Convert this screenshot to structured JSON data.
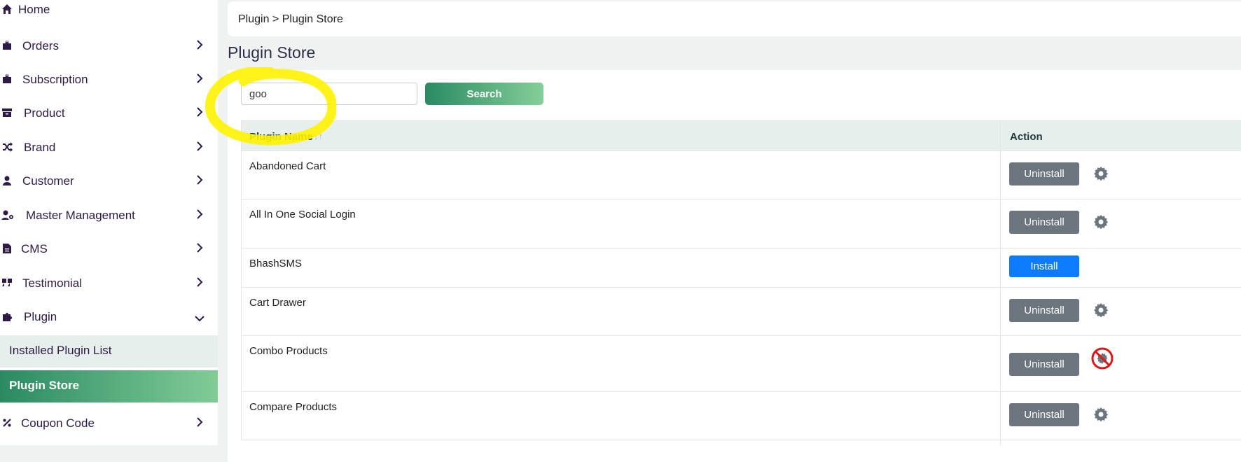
{
  "sidebar": {
    "items": [
      {
        "label": "Home",
        "icon": "home-icon"
      },
      {
        "label": "Orders",
        "icon": "bag-icon"
      },
      {
        "label": "Subscription",
        "icon": "bag-icon"
      },
      {
        "label": "Product",
        "icon": "box-icon"
      },
      {
        "label": "Brand",
        "icon": "shuffle-icon"
      },
      {
        "label": "Customer",
        "icon": "user-icon"
      },
      {
        "label": "Master Management",
        "icon": "user-gear-icon"
      },
      {
        "label": "CMS",
        "icon": "document-icon"
      },
      {
        "label": "Testimonial",
        "icon": "quote-icon"
      },
      {
        "label": "Plugin",
        "icon": "puzzle-icon"
      },
      {
        "label": "Coupon Code",
        "icon": "percent-icon"
      }
    ],
    "plugin_sub": [
      {
        "label": "Installed Plugin List"
      },
      {
        "label": "Plugin Store"
      }
    ]
  },
  "breadcrumb": "Plugin > Plugin Store",
  "page_title": "Plugin Store",
  "search": {
    "value": "goo",
    "button_label": "Search"
  },
  "table": {
    "headers": {
      "name": "Plugin Name",
      "action": "Action"
    },
    "rows": [
      {
        "name": "Abandoned Cart",
        "button": "Uninstall",
        "settings": "gear-icon"
      },
      {
        "name": "All In One Social Login",
        "button": "Uninstall",
        "settings": "gear-icon"
      },
      {
        "name": "BhashSMS",
        "button": "Install",
        "settings": ""
      },
      {
        "name": "Cart Drawer",
        "button": "Uninstall",
        "settings": "gear-icon"
      },
      {
        "name": "Combo Products",
        "button": "Uninstall",
        "settings": "no-settings-icon"
      },
      {
        "name": "Compare Products",
        "button": "Uninstall",
        "settings": "gear-icon"
      }
    ]
  },
  "colors": {
    "accent_gradient_start": "#2a8a62",
    "accent_gradient_end": "#85cf99",
    "install_blue": "#0d7bff",
    "uninstall_gray": "#6c757d",
    "highlight_yellow": "#fff200"
  }
}
